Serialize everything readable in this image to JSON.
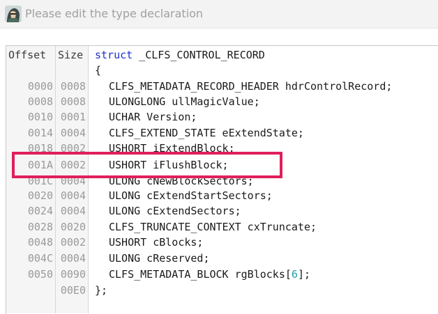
{
  "window": {
    "title": "Please edit the type declaration",
    "icon": "hacker-avatar-icon"
  },
  "headers": {
    "offset": "Offset",
    "size": "Size"
  },
  "struct": {
    "keyword": "struct",
    "name": " _CLFS_CONTROL_RECORD",
    "open_brace": "{",
    "close_brace": "};",
    "end_size": "00E0",
    "fields": [
      {
        "offset": "0000",
        "size": "0008",
        "decl": "CLFS_METADATA_RECORD_HEADER hdrControlRecord;"
      },
      {
        "offset": "0008",
        "size": "0008",
        "decl": "ULONGLONG ullMagicValue;"
      },
      {
        "offset": "0010",
        "size": "0001",
        "decl": "UCHAR Version;"
      },
      {
        "offset": "0014",
        "size": "0004",
        "decl": "CLFS_EXTEND_STATE eExtendState;"
      },
      {
        "offset": "0018",
        "size": "0002",
        "decl": "USHORT iExtendBlock;"
      },
      {
        "offset": "001A",
        "size": "0002",
        "decl": "USHORT iFlushBlock;"
      },
      {
        "offset": "001C",
        "size": "0004",
        "decl": "ULONG cNewBlockSectors;"
      },
      {
        "offset": "0020",
        "size": "0004",
        "decl": "ULONG cExtendStartSectors;"
      },
      {
        "offset": "0024",
        "size": "0004",
        "decl": "ULONG cExtendSectors;"
      },
      {
        "offset": "0028",
        "size": "0020",
        "decl": "CLFS_TRUNCATE_CONTEXT cxTruncate;"
      },
      {
        "offset": "0048",
        "size": "0002",
        "decl": "USHORT cBlocks;"
      },
      {
        "offset": "004C",
        "size": "0004",
        "decl": "ULONG cReserved;"
      },
      {
        "offset": "0050",
        "size": "0090",
        "decl_prefix": "CLFS_METADATA_BLOCK rgBlocks[",
        "decl_num": "6",
        "decl_suffix": "];"
      }
    ]
  },
  "highlight": {
    "field_index": 5,
    "color": "#e01f5c"
  },
  "colors": {
    "keyword": "#1f2fd0",
    "number": "#1aa0a8",
    "gutter_text": "#9a9a9a"
  }
}
